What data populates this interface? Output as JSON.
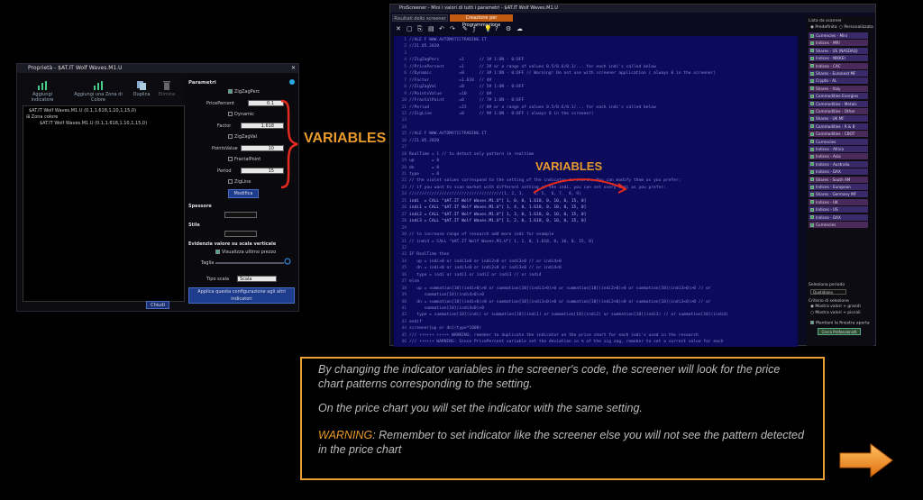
{
  "left_window": {
    "title": "Proprietà - $AT.IT Wolf Waves.M1.U",
    "close_glyph": "✕",
    "buttons": {
      "add_indicator": "Aggiungi indicatore",
      "add_color_zone": "Aggiungi una Zona di Colore",
      "duplicate": "Duplica",
      "remove": "Elimina"
    },
    "tree": [
      "$AT.IT Wolf Waves.M1.U (0.1,1.618,1.10,1,15,0)",
      "Zona colore",
      "$AT.IT Wolf Waves.M1.U (0.1,1.618,1.10,1,15,0)"
    ],
    "params": {
      "title": "Parametri",
      "zigzag_perc": "ZigZagPerc",
      "price_percent_label": "PricePercent",
      "price_percent_value": "0.1",
      "dynamic": "Dynamic",
      "factor_label": "Factor",
      "factor_value": "1.618",
      "zigzag_val": "ZigZagVal",
      "points_value_label": "PointsValue",
      "points_value_value": "10",
      "fractal_point": "FractalPoint",
      "period_label": "Period",
      "period_value": "15",
      "zigline": "ZigLine",
      "modify": "Modifica",
      "thickness": "Spessore",
      "style": "Stile",
      "scale_section": "Evidenzia valore su scala verticale",
      "show_last_price": "Visualizza ultimo prezzo",
      "size": "Taglia",
      "scale_type_label": "Tipo scala",
      "scale_type_value": "Scala lineare",
      "apply_all": "Applica questa configurazione agli altri indicatori",
      "close": "Chiudi"
    }
  },
  "annotations": {
    "variables_left": "VARIABLES",
    "variables_right": "VARIABLES"
  },
  "right_window": {
    "title": "ProScreener - Mini i valori di tutti i parametri - $AT.IT Wolf Waves.M1.U",
    "tabs": [
      "Risultati dello screener",
      "Creazione per Programmazione"
    ],
    "code_lines": [
      "//ALE F WWW.AUTOMATICTRADING.IT",
      "//21.05.2020",
      "",
      "//ZigZagPerc        =1      // 1# 1:ON - 0:OFF",
      "//PricePercent      =1      // 2# or a range of values 0.5/0.6/0.1/... for each indi's called below",
      "//Dynamic           =0      // 3# 1:ON - 0:OFF // Warning! Do not use with screener application ( always 0 in the screener)",
      "//Factor            =1.618  // 4#",
      "//ZigZagVal         =0      // 5# 1:ON - 0:OFF",
      "//PointsValue       =10     // 6#",
      "//FractalPoint      =0      // 7# 1:ON - 0:OFF",
      "//Period            =15     // 8# or a range of values 0.5/0.6/0.1/... for each indi's called below",
      "//ZigLine           =0      // 9# 1:ON - 0:OFF ( always 0 in the screener)",
      "",
      "",
      "//ALE F WWW.AUTOMATICTRADING.IT",
      "//21.05.2020",
      "",
      "RealTime = 1 // to detect only pattern in realtime",
      "up       = 0",
      "dn       = 0",
      "type     = 0",
      "// the violet values correspond to the setting of the indicator to search, You can modify them as you prefer:",
      "// if you want to scan market with different setting of the indi, you can set every indi as you prefer:",
      "/////////////////////////////////////(1, 2, 3,    4, 5,  6, 7,  8, 9)",
      "indi  = CALL \"$AT.IT Wolf Waves.M1.U\"[ 1, 0, 0, 1.618, 0, 10, 0, 15, 0]",
      "indi1 = CALL \"$AT.IT Wolf Waves.M1.U\"[ 1, 4, 0, 1.618, 0, 10, 0, 15, 0]",
      "indi2 = CALL \"$AT.IT Wolf Waves.M1.U\"[ 1, 3, 0, 1.618, 0, 10, 0, 15, 0]",
      "indi3 = CALL \"$AT.IT Wolf Waves.M1.U\"[ 1, 2, 0, 1.618, 0, 10, 0, 15, 0]",
      "",
      "// to increase range of research add more indi for example",
      "// indi4 = CALL \"$AT.IT Wolf Waves.M1.U\"[ 1, 1, 0, 1.618, 0, 10, 0, 15, 0]",
      "",
      "IF RealTime then",
      "   up = indi>0 or indi1>0 or indi2>0 or indi3>0 // or indi4>0",
      "   dn = indi<0 or indi1<0 or indi2<0 or indi3<0 // or indi4<0",
      "   type = indi or indi1 or indi2 or indi3 // or indi4",
      "else",
      "   up = summation[10](indi>0)>0 or summation[10](indi1>0)>0 or summation[10](indi2>0)>0 or summation[10](indi3>0)>0 // or",
      "      summation[10](indi4>0)>0",
      "   dn = summation[10](indi<0)>0 or summation[10](indi1<0)>0 or summation[10](indi2<0)>0 or summation[10](indi3<0)>0 // or",
      "      summation[10](indi4<0)>0",
      "   type = summation[10](indi) or summation[10](indi1) or summation[10](indi2) or summation[10](indi3) // or summation[10](indi4)",
      "endif",
      "screener[up or dn](type*1000)",
      "/// ++++++ +++++ WARNING: remeber to duplicate the indicator on the price chart for each indi's used in the research",
      "/// ++++++ WARNING: Since PricePercent variable set the deviation in % of the zig zag, remeber to set a correct value for each"
    ],
    "side": {
      "list_title": "Lista da scanner",
      "radio_predefined": "Predefinita",
      "radio_custom": "Personalizzata",
      "items": [
        "Currencies - Mini",
        "Indices - MRI",
        "Shares - US (NASDAQ)",
        "Indices - NIKKEI",
        "Indices - CAC",
        "Shares - Euronext MF",
        "Crypto - AL",
        "Shares - Italy",
        "Commodities-Energies",
        "Commodities - Metals",
        "Commodities - Other",
        "Shares - UK MF",
        "Commodities - R & B",
        "Commodities - CBOT",
        "Currencies",
        "Indices - Africa",
        "Indices - Asia",
        "Indices - Australia",
        "Indices - DAX",
        "Shares - South AM",
        "Indices - European",
        "Shares - Germany MF",
        "Indices - UK",
        "Indices - US",
        "Indices - DAX",
        "Currencies"
      ],
      "period_title": "Seleziona periodo",
      "period_value": "Quotidiano",
      "criteria_title": "Criterio di selezione",
      "criteria_a": "Mostra valori + grandi",
      "criteria_b": "Mostra valori + piccoli",
      "show_window": "Mantieni la finestra aperta",
      "button": "Cerca Professionisti"
    }
  },
  "note": {
    "p1": "By changing the indicator variables in the screener's code, the screener will look for the price chart  patterns corresponding to the setting.",
    "p2": "On the price chart you will set the indicator with the same setting.",
    "p3_warning": "WARNING",
    "p3_rest": ": Remember to set indicator like the screener else you will not see the pattern detected in the price chart"
  },
  "colors": {
    "accent_orange": "#e89a2a",
    "code_bg": "#0c0a5a",
    "list_item_bg": "#3a2a6a"
  }
}
